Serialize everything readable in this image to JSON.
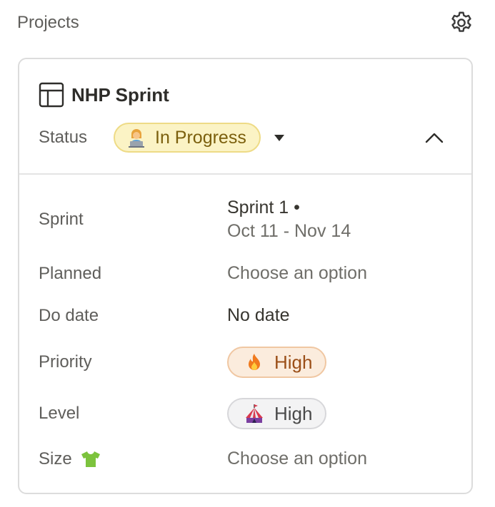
{
  "header": {
    "title": "Projects",
    "settings_icon": "gear-icon"
  },
  "card": {
    "title": "NHP Sprint",
    "title_icon": "table-icon",
    "status": {
      "label": "Status",
      "value": "In Progress",
      "emoji": "technologist-emoji",
      "color": "#fbf3c5"
    }
  },
  "properties": {
    "sprint": {
      "label": "Sprint",
      "name": "Sprint 1 •",
      "dates": "Oct 11 - Nov 14"
    },
    "planned": {
      "label": "Planned",
      "value": "Choose an option"
    },
    "do_date": {
      "label": "Do date",
      "value": "No date"
    },
    "priority": {
      "label": "Priority",
      "value": "High",
      "emoji": "fire-emoji",
      "color": "#fbecdd"
    },
    "level": {
      "label": "Level",
      "value": "High",
      "emoji": "circus-tent-emoji",
      "color": "#f3f3f4"
    },
    "size": {
      "label": "Size",
      "emoji": "tshirt-emoji",
      "value": "Choose an option"
    }
  }
}
